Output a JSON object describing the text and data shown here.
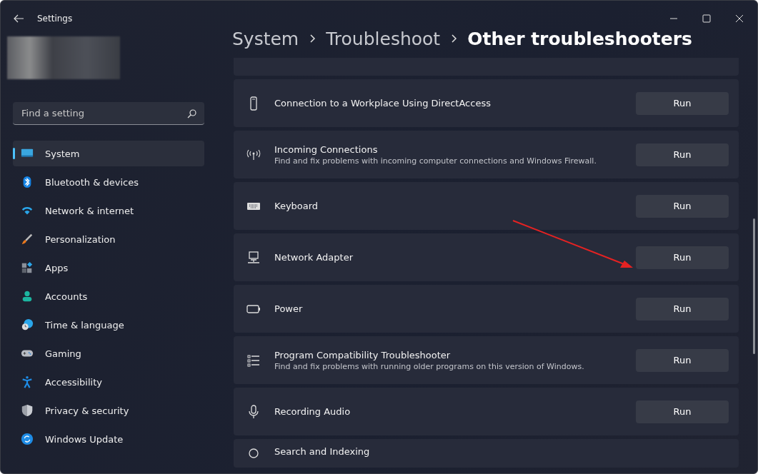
{
  "window": {
    "title": "Settings"
  },
  "breadcrumb": [
    "System",
    "Troubleshoot",
    "Other troubleshooters"
  ],
  "search": {
    "placeholder": "Find a setting"
  },
  "nav": [
    {
      "label": "System",
      "selected": true
    },
    {
      "label": "Bluetooth & devices",
      "selected": false
    },
    {
      "label": "Network & internet",
      "selected": false
    },
    {
      "label": "Personalization",
      "selected": false
    },
    {
      "label": "Apps",
      "selected": false
    },
    {
      "label": "Accounts",
      "selected": false
    },
    {
      "label": "Time & language",
      "selected": false
    },
    {
      "label": "Gaming",
      "selected": false
    },
    {
      "label": "Accessibility",
      "selected": false
    },
    {
      "label": "Privacy & security",
      "selected": false
    },
    {
      "label": "Windows Update",
      "selected": false
    }
  ],
  "troubleshooters": [
    {
      "title": "Connection to a Workplace Using DirectAccess",
      "button": "Run"
    },
    {
      "title": "Incoming Connections",
      "description": "Find and fix problems with incoming computer connections and Windows Firewall.",
      "button": "Run"
    },
    {
      "title": "Keyboard",
      "button": "Run"
    },
    {
      "title": "Network Adapter",
      "button": "Run"
    },
    {
      "title": "Power",
      "button": "Run"
    },
    {
      "title": "Program Compatibility Troubleshooter",
      "description": "Find and fix problems with running older programs on this version of Windows.",
      "button": "Run"
    },
    {
      "title": "Recording Audio",
      "button": "Run"
    },
    {
      "title": "Search and Indexing"
    }
  ]
}
